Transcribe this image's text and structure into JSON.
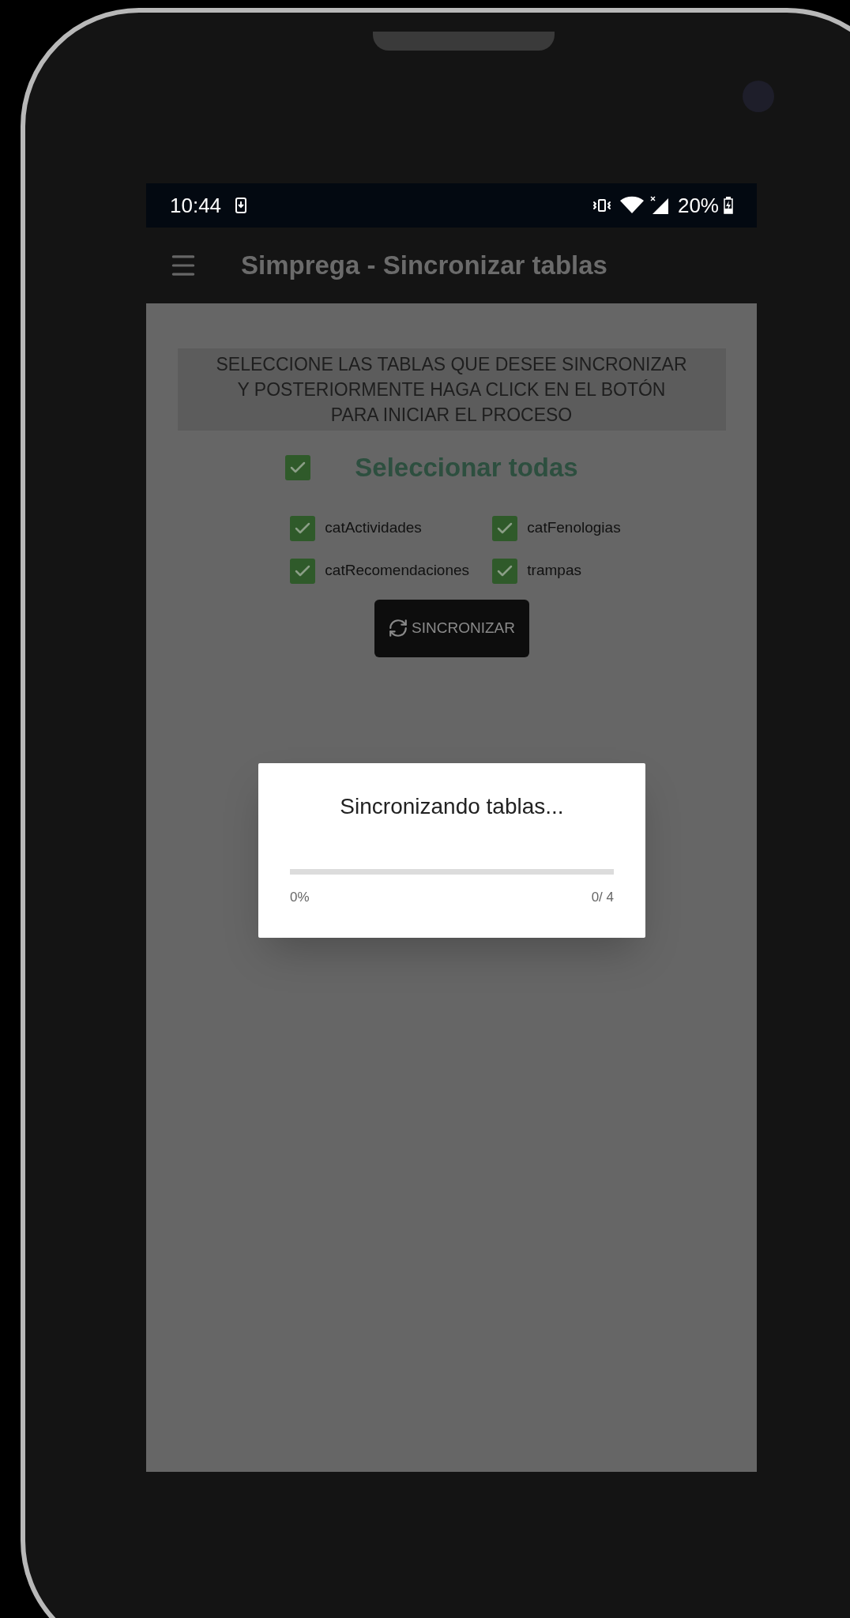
{
  "status_bar": {
    "time": "10:44",
    "battery": "20%"
  },
  "app_bar": {
    "title": "Simprega - Sincronizar tablas"
  },
  "instructions": "SELECCIONE LAS TABLAS QUE DESEE SINCRONIZAR\nY POSTERIORMENTE HAGA CLICK EN EL BOTÓN\nPARA INICIAR EL PROCESO",
  "select_all": {
    "label": "Seleccionar todas",
    "checked": true
  },
  "tables": [
    {
      "label": "catActividades",
      "checked": true
    },
    {
      "label": "catFenologias",
      "checked": true
    },
    {
      "label": "catRecomendaciones",
      "checked": true
    },
    {
      "label": "trampas",
      "checked": true
    }
  ],
  "sync_button": {
    "label": "SINCRONIZAR"
  },
  "dialog": {
    "title": "Sincronizando tablas...",
    "level": 0,
    "percent": "0%",
    "count": "0/ 4"
  }
}
